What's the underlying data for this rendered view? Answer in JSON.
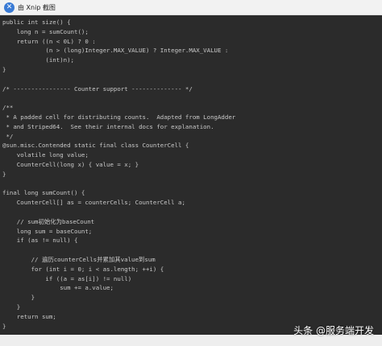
{
  "window": {
    "title": "由 Xnip 截图",
    "icon": "xnip-app-icon"
  },
  "code_lines": [
    "public int size() {",
    "    long n = sumCount();",
    "    return ((n < 0L) ? 0 :",
    "            (n > (long)Integer.MAX_VALUE) ? Integer.MAX_VALUE :",
    "            (int)n);",
    "}",
    "",
    "/* ---------------- Counter support -------------- */",
    "",
    "/**",
    " * A padded cell for distributing counts.  Adapted from LongAdder",
    " * and Striped64.  See their internal docs for explanation.",
    " */",
    "@sun.misc.Contended static final class CounterCell {",
    "    volatile long value;",
    "    CounterCell(long x) { value = x; }",
    "}",
    "",
    "final long sumCount() {",
    "    CounterCell[] as = counterCells; CounterCell a;",
    "",
    "    // sum初始化为baseCount",
    "    long sum = baseCount;",
    "    if (as != null) {",
    "",
    "        // 遍历counterCells并累加其value到sum",
    "        for (int i = 0; i < as.length; ++i) {",
    "            if ((a = as[i]) != null)",
    "                sum += a.value;",
    "        }",
    "    }",
    "    return sum;",
    "}"
  ],
  "watermark": "头条 @服务端开发",
  "colors": {
    "editor_background": "#2b2b2b",
    "code_text": "#c9c9c9",
    "titlebar_background": "#f2f2f2"
  }
}
